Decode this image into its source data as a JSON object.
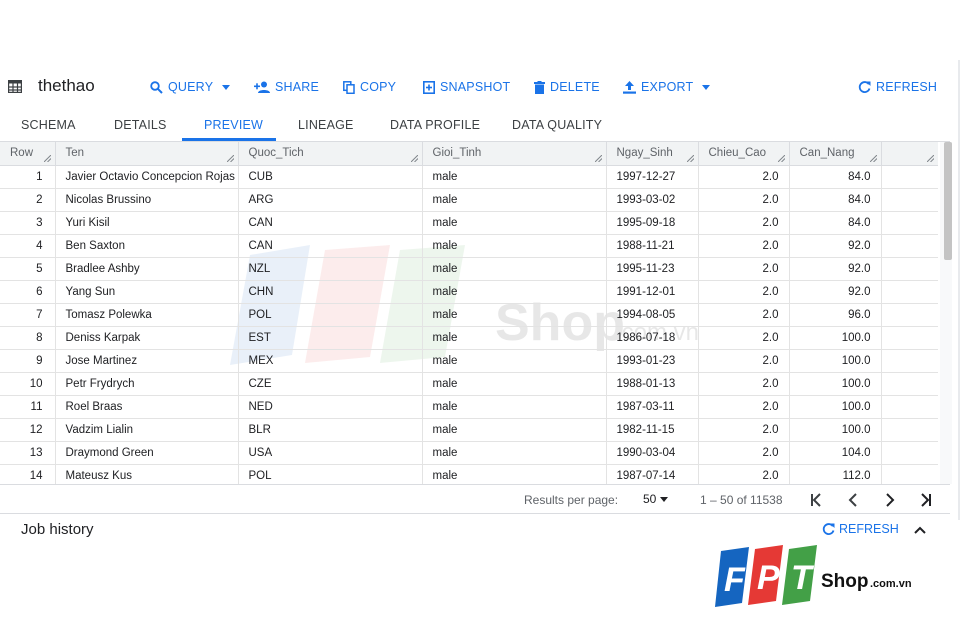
{
  "toolbar": {
    "table_name": "thethao",
    "query": "QUERY",
    "share": "SHARE",
    "copy": "COPY",
    "snapshot": "SNAPSHOT",
    "delete": "DELETE",
    "export": "EXPORT",
    "refresh": "REFRESH"
  },
  "tabs": [
    "SCHEMA",
    "DETAILS",
    "PREVIEW",
    "LINEAGE",
    "DATA PROFILE",
    "DATA QUALITY"
  ],
  "active_tab": "PREVIEW",
  "table": {
    "columns": [
      "Row",
      "Ten",
      "Quoc_Tich",
      "Gioi_Tinh",
      "Ngay_Sinh",
      "Chieu_Cao",
      "Can_Nang",
      ""
    ],
    "rows": [
      [
        "1",
        "Javier Octavio Concepcion Rojas",
        "CUB",
        "male",
        "1997-12-27",
        "2.0",
        "84.0"
      ],
      [
        "2",
        "Nicolas Brussino",
        "ARG",
        "male",
        "1993-03-02",
        "2.0",
        "84.0"
      ],
      [
        "3",
        "Yuri Kisil",
        "CAN",
        "male",
        "1995-09-18",
        "2.0",
        "84.0"
      ],
      [
        "4",
        "Ben Saxton",
        "CAN",
        "male",
        "1988-11-21",
        "2.0",
        "92.0"
      ],
      [
        "5",
        "Bradlee Ashby",
        "NZL",
        "male",
        "1995-11-23",
        "2.0",
        "92.0"
      ],
      [
        "6",
        "Yang Sun",
        "CHN",
        "male",
        "1991-12-01",
        "2.0",
        "92.0"
      ],
      [
        "7",
        "Tomasz Polewka",
        "POL",
        "male",
        "1994-08-05",
        "2.0",
        "96.0"
      ],
      [
        "8",
        "Deniss Karpak",
        "EST",
        "male",
        "1986-07-18",
        "2.0",
        "100.0"
      ],
      [
        "9",
        "Jose Martinez",
        "MEX",
        "male",
        "1993-01-23",
        "2.0",
        "100.0"
      ],
      [
        "10",
        "Petr Frydrych",
        "CZE",
        "male",
        "1988-01-13",
        "2.0",
        "100.0"
      ],
      [
        "11",
        "Roel Braas",
        "NED",
        "male",
        "1987-03-11",
        "2.0",
        "100.0"
      ],
      [
        "12",
        "Vadzim Lialin",
        "BLR",
        "male",
        "1982-11-15",
        "2.0",
        "100.0"
      ],
      [
        "13",
        "Draymond Green",
        "USA",
        "male",
        "1990-03-04",
        "2.0",
        "104.0"
      ],
      [
        "14",
        "Mateusz Kus",
        "POL",
        "male",
        "1987-07-14",
        "2.0",
        "112.0"
      ]
    ]
  },
  "pager": {
    "results_label": "Results per page:",
    "per_page": "50",
    "range": "1 – 50 of 11538"
  },
  "job_history": {
    "title": "Job history",
    "refresh": "REFRESH"
  },
  "logo": {
    "letters": [
      "F",
      "P",
      "T"
    ],
    "shop": "Shop",
    "domain": ".com.vn"
  },
  "colors": {
    "accent": "#1a73e8",
    "logo_blue": "#1565c0",
    "logo_red": "#e53935",
    "logo_green": "#43a047"
  }
}
